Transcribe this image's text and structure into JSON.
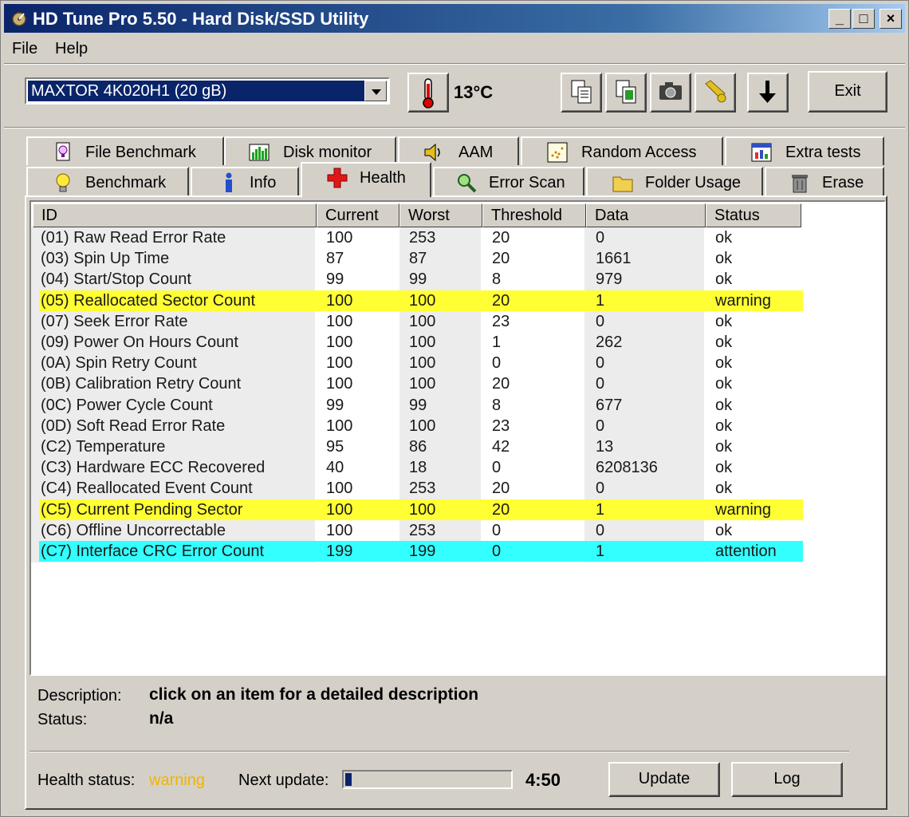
{
  "window": {
    "title": "HD Tune Pro 5.50 - Hard Disk/SSD Utility",
    "buttons": [
      "_",
      "□",
      "×"
    ]
  },
  "menu": {
    "file": "File",
    "help": "Help"
  },
  "toolbar": {
    "drive": "MAXTOR 4K020H1 (20 gB)",
    "temperature": "13°C",
    "exit_label": "Exit",
    "icons": [
      "copy-text-icon",
      "copy-info-icon",
      "screenshot-icon",
      "options-icon",
      "save-down-icon"
    ]
  },
  "tabs": {
    "top": [
      {
        "label": "File Benchmark",
        "icon": "file-benchmark-icon"
      },
      {
        "label": "Disk monitor",
        "icon": "disk-monitor-icon"
      },
      {
        "label": "AAM",
        "icon": "speaker-icon"
      },
      {
        "label": "Random Access",
        "icon": "random-access-icon"
      },
      {
        "label": "Extra tests",
        "icon": "extra-tests-icon"
      }
    ],
    "bottom": [
      {
        "label": "Benchmark",
        "icon": "lightbulb-icon"
      },
      {
        "label": "Info",
        "icon": "info-icon"
      },
      {
        "label": "Health",
        "icon": "health-cross-icon"
      },
      {
        "label": "Error Scan",
        "icon": "magnifier-icon"
      },
      {
        "label": "Folder Usage",
        "icon": "folder-icon"
      },
      {
        "label": "Erase",
        "icon": "trash-icon"
      }
    ],
    "active": "Health"
  },
  "table": {
    "columns": [
      "ID",
      "Current",
      "Worst",
      "Threshold",
      "Data",
      "Status"
    ],
    "rows": [
      {
        "id": "(01) Raw Read Error Rate",
        "current": "100",
        "worst": "253",
        "threshold": "20",
        "data": "0",
        "status": "ok",
        "highlight": ""
      },
      {
        "id": "(03) Spin Up Time",
        "current": "87",
        "worst": "87",
        "threshold": "20",
        "data": "1661",
        "status": "ok",
        "highlight": ""
      },
      {
        "id": "(04) Start/Stop Count",
        "current": "99",
        "worst": "99",
        "threshold": "8",
        "data": "979",
        "status": "ok",
        "highlight": ""
      },
      {
        "id": "(05) Reallocated Sector Count",
        "current": "100",
        "worst": "100",
        "threshold": "20",
        "data": "1",
        "status": "warning",
        "highlight": "#ffff33"
      },
      {
        "id": "(07) Seek Error Rate",
        "current": "100",
        "worst": "100",
        "threshold": "23",
        "data": "0",
        "status": "ok",
        "highlight": ""
      },
      {
        "id": "(09) Power On Hours Count",
        "current": "100",
        "worst": "100",
        "threshold": "1",
        "data": "262",
        "status": "ok",
        "highlight": ""
      },
      {
        "id": "(0A) Spin Retry Count",
        "current": "100",
        "worst": "100",
        "threshold": "0",
        "data": "0",
        "status": "ok",
        "highlight": ""
      },
      {
        "id": "(0B) Calibration Retry Count",
        "current": "100",
        "worst": "100",
        "threshold": "20",
        "data": "0",
        "status": "ok",
        "highlight": ""
      },
      {
        "id": "(0C) Power Cycle Count",
        "current": "99",
        "worst": "99",
        "threshold": "8",
        "data": "677",
        "status": "ok",
        "highlight": ""
      },
      {
        "id": "(0D) Soft Read Error Rate",
        "current": "100",
        "worst": "100",
        "threshold": "23",
        "data": "0",
        "status": "ok",
        "highlight": ""
      },
      {
        "id": "(C2) Temperature",
        "current": "95",
        "worst": "86",
        "threshold": "42",
        "data": "13",
        "status": "ok",
        "highlight": ""
      },
      {
        "id": "(C3) Hardware ECC Recovered",
        "current": "40",
        "worst": "18",
        "threshold": "0",
        "data": "6208136",
        "status": "ok",
        "highlight": ""
      },
      {
        "id": "(C4) Reallocated Event Count",
        "current": "100",
        "worst": "253",
        "threshold": "20",
        "data": "0",
        "status": "ok",
        "highlight": ""
      },
      {
        "id": "(C5) Current Pending Sector",
        "current": "100",
        "worst": "100",
        "threshold": "20",
        "data": "1",
        "status": "warning",
        "highlight": "#ffff33"
      },
      {
        "id": "(C6) Offline Uncorrectable",
        "current": "100",
        "worst": "253",
        "threshold": "0",
        "data": "0",
        "status": "ok",
        "highlight": ""
      },
      {
        "id": "(C7) Interface CRC Error Count",
        "current": "199",
        "worst": "199",
        "threshold": "0",
        "data": "1",
        "status": "attention",
        "highlight": "#33ffff"
      }
    ]
  },
  "details": {
    "description_label": "Description:",
    "description_value": "click on an item for a detailed description",
    "status_label": "Status:",
    "status_value": "n/a"
  },
  "footer": {
    "health_label": "Health status:",
    "health_value": "warning",
    "health_color": "#f0b400",
    "next_update_label": "Next update:",
    "next_update_progress": 0.04,
    "next_update_time": "4:50",
    "update_label": "Update",
    "log_label": "Log"
  }
}
